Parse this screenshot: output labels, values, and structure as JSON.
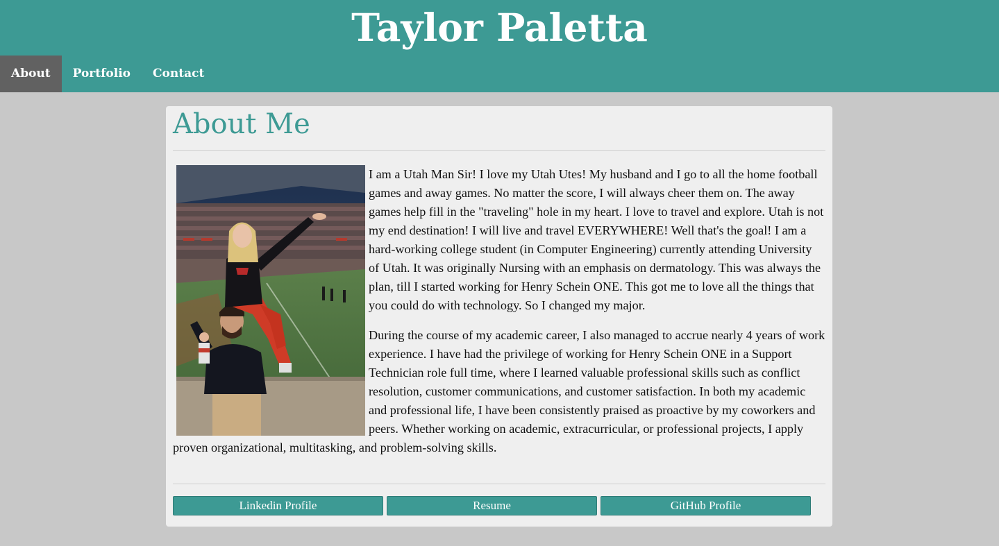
{
  "site": {
    "title": "Taylor Paletta"
  },
  "nav": {
    "items": [
      {
        "label": "About",
        "active": true
      },
      {
        "label": "Portfolio",
        "active": false
      },
      {
        "label": "Contact",
        "active": false
      }
    ]
  },
  "about": {
    "heading": "About Me",
    "photo_icon": "photo-icon",
    "paragraphs": [
      "I am a Utah Man Sir! I love my Utah Utes! My husband and I go to all the home football games and away games. No matter the score, I will always cheer them on. The away games help fill in the \"traveling\" hole in my heart. I love to travel and explore. Utah is not my end destination! I will live and travel EVERYWHERE! Well that's the goal! I am a hard-working college student (in Computer Engineering) currently attending University of Utah. It was originally Nursing with an emphasis on dermatology. This was always the plan, till I started working for Henry Schein ONE. This got me to love all the things that you could do with technology. So I changed my major.",
      "During the course of my academic career, I also managed to accrue nearly 4 years of work experience. I have had the privilege of working for Henry Schein ONE in a Support Technician role full time, where I learned valuable professional skills such as conflict resolution, customer communications, and customer satisfaction. In both my academic and professional life, I have been consistently praised as proactive by my coworkers and peers. Whether working on academic, extracurricular, or professional projects, I apply proven organizational, multitasking, and problem-solving skills."
    ]
  },
  "buttons": {
    "linkedin": "Linkedin Profile",
    "resume": "Resume",
    "github": "GitHub Profile"
  },
  "colors": {
    "brand": "#3d9a94",
    "nav_active": "#616161",
    "page_bg": "#c8c8c8",
    "card_bg": "#efefef"
  }
}
